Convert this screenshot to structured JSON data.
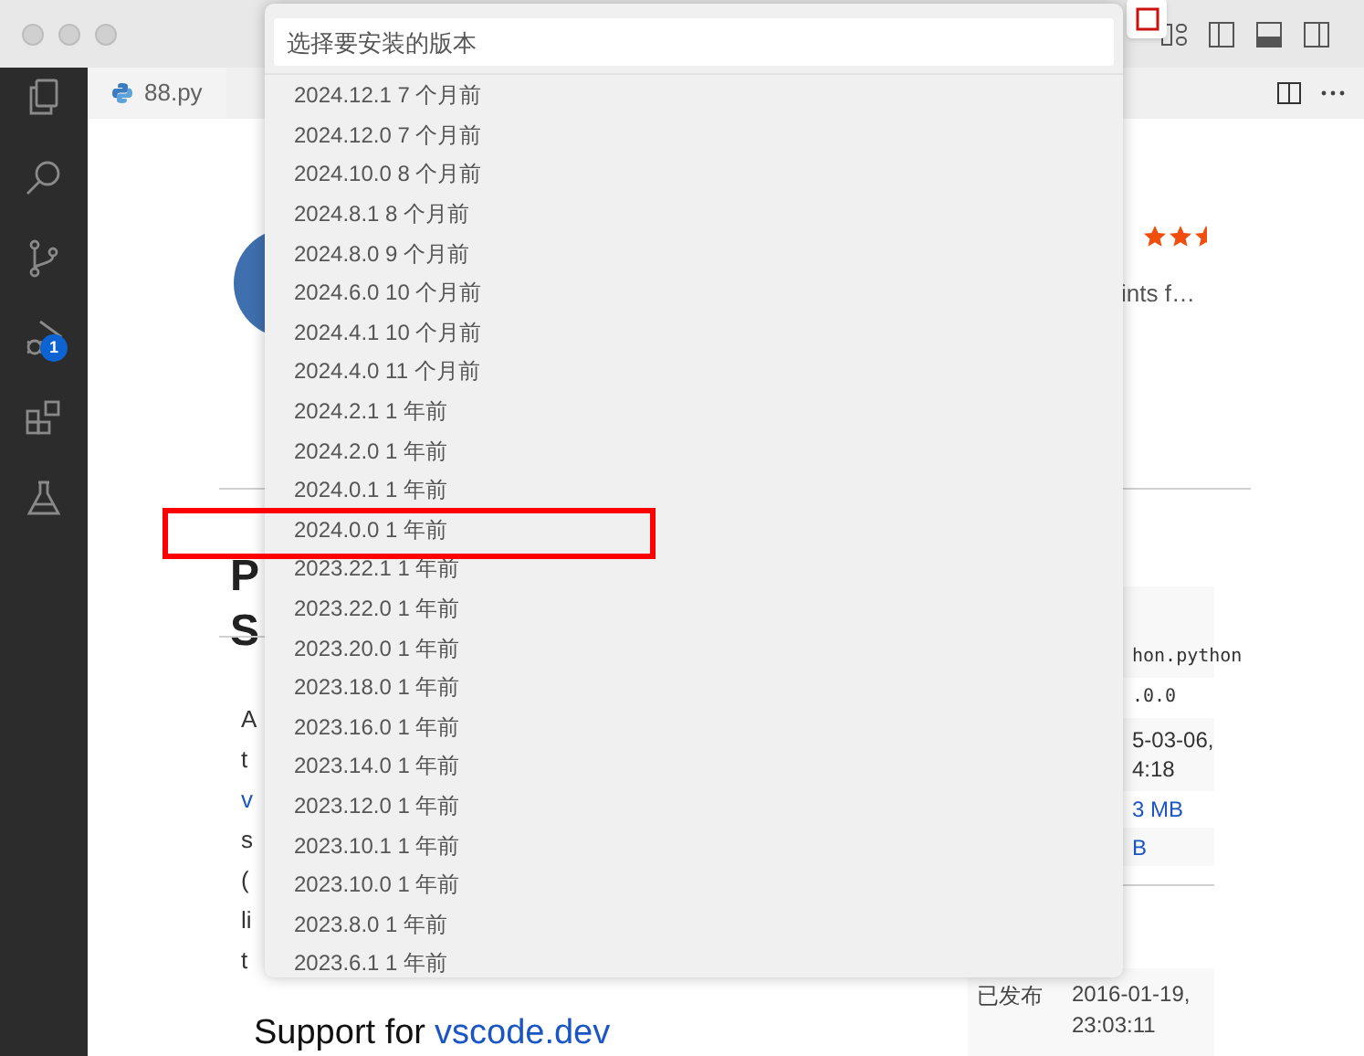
{
  "activity_bar": {
    "items": [
      {
        "kind": "files"
      },
      {
        "kind": "search"
      },
      {
        "kind": "source-control"
      },
      {
        "kind": "run-debug",
        "badge": "1"
      },
      {
        "kind": "extensions"
      },
      {
        "kind": "testing"
      }
    ]
  },
  "tab": {
    "label": "88.py"
  },
  "quick_pick": {
    "placeholder": "选择要安装的版本",
    "items": [
      {
        "version": "2024.12.1",
        "age": "7 个月前",
        "highlighted": false
      },
      {
        "version": "2024.12.0",
        "age": "7 个月前",
        "highlighted": false
      },
      {
        "version": "2024.10.0",
        "age": "8 个月前",
        "highlighted": false
      },
      {
        "version": "2024.8.1",
        "age": "8 个月前",
        "highlighted": false
      },
      {
        "version": "2024.8.0",
        "age": "9 个月前",
        "highlighted": false
      },
      {
        "version": "2024.6.0",
        "age": "10 个月前",
        "highlighted": false
      },
      {
        "version": "2024.4.1",
        "age": "10 个月前",
        "highlighted": false
      },
      {
        "version": "2024.4.0",
        "age": "11 个月前",
        "highlighted": false
      },
      {
        "version": "2024.2.1",
        "age": "1 年前",
        "highlighted": false
      },
      {
        "version": "2024.2.0",
        "age": "1 年前",
        "highlighted": false
      },
      {
        "version": "2024.0.1",
        "age": "1 年前",
        "highlighted": false
      },
      {
        "version": "2024.0.0",
        "age": "1 年前",
        "highlighted": true
      },
      {
        "version": "2023.22.1",
        "age": "1 年前",
        "highlighted": false
      },
      {
        "version": "2023.22.0",
        "age": "1 年前",
        "highlighted": false
      },
      {
        "version": "2023.20.0",
        "age": "1 年前",
        "highlighted": false
      },
      {
        "version": "2023.18.0",
        "age": "1 年前",
        "highlighted": false
      },
      {
        "version": "2023.16.0",
        "age": "1 年前",
        "highlighted": false
      },
      {
        "version": "2023.14.0",
        "age": "1 年前",
        "highlighted": false
      },
      {
        "version": "2023.12.0",
        "age": "1 年前",
        "highlighted": false
      },
      {
        "version": "2023.10.1",
        "age": "1 年前",
        "highlighted": false
      },
      {
        "version": "2023.10.0",
        "age": "1 年前",
        "highlighted": false
      },
      {
        "version": "2023.8.0",
        "age": "1 年前",
        "highlighted": false
      },
      {
        "version": "2023.6.1",
        "age": "1 年前",
        "highlighted": false
      }
    ]
  },
  "extension": {
    "heading_fragments": [
      "P",
      "S"
    ],
    "rating": {
      "stars": 2.5
    },
    "description": "ints f…",
    "readme_fragments": [
      {
        "text": "A",
        "kind": "text"
      },
      {
        "text": "t",
        "kind": "text"
      },
      {
        "text": "v",
        "kind": "link"
      },
      {
        "text": "s",
        "kind": "text"
      },
      {
        "text": "(",
        "kind": "text"
      },
      {
        "text": "li",
        "kind": "text"
      },
      {
        "text": "t",
        "kind": "text"
      }
    ],
    "details": [
      {
        "lines": [
          "hon.python"
        ],
        "kind": "mono"
      },
      {
        "lines": [
          ".0.0"
        ],
        "kind": "mono"
      },
      {
        "lines": [
          "5-03-06,",
          "4:18"
        ],
        "kind": "text"
      },
      {
        "lines": [
          "3 MB"
        ],
        "kind": "link"
      },
      {
        "lines": [
          "B"
        ],
        "kind": "link"
      }
    ],
    "published": {
      "label": "已发布",
      "value": "2016-01-19, 23:03:11"
    },
    "support": {
      "text": "Support for",
      "link": "vscode.dev"
    }
  }
}
